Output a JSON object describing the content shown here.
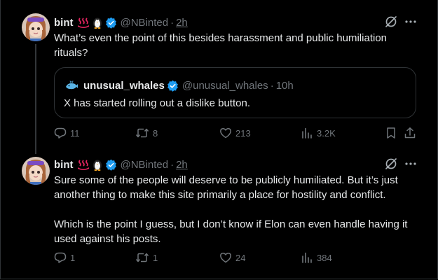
{
  "posts": [
    {
      "author": {
        "name": "bint",
        "emoji": [
          "hot-springs-emoji",
          "penguin-emoji"
        ],
        "verified": true,
        "handle": "@NBinted",
        "time": "2h"
      },
      "text": [
        "What’s even the point of this besides harassment and public humiliation rituals?"
      ],
      "quote": {
        "name": "unusual_whales",
        "verified": true,
        "handle": "@unusual_whales",
        "time": "10h",
        "text": "X has started rolling out a dislike button."
      },
      "actions": {
        "replies": "11",
        "reposts": "8",
        "likes": "213",
        "views": "3.2K"
      }
    },
    {
      "author": {
        "name": "bint",
        "emoji": [
          "hot-springs-emoji",
          "penguin-emoji"
        ],
        "verified": true,
        "handle": "@NBinted",
        "time": "2h"
      },
      "text": [
        "Sure some of the people will deserve to be publicly humiliated. But it’s just another thing to make this site primarily a place for hostility and conflict.",
        "Which is the point I guess, but I don’t know if Elon can even handle having it used against his posts."
      ],
      "actions": {
        "replies": "1",
        "reposts": "1",
        "likes": "24",
        "views": "384"
      }
    }
  ],
  "symbols": {
    "dot": "·"
  },
  "colors": {
    "background": "#000000",
    "text": "#e7e9ea",
    "muted": "#71767b",
    "border": "#2f3336",
    "verified": "#1d9bf0"
  }
}
